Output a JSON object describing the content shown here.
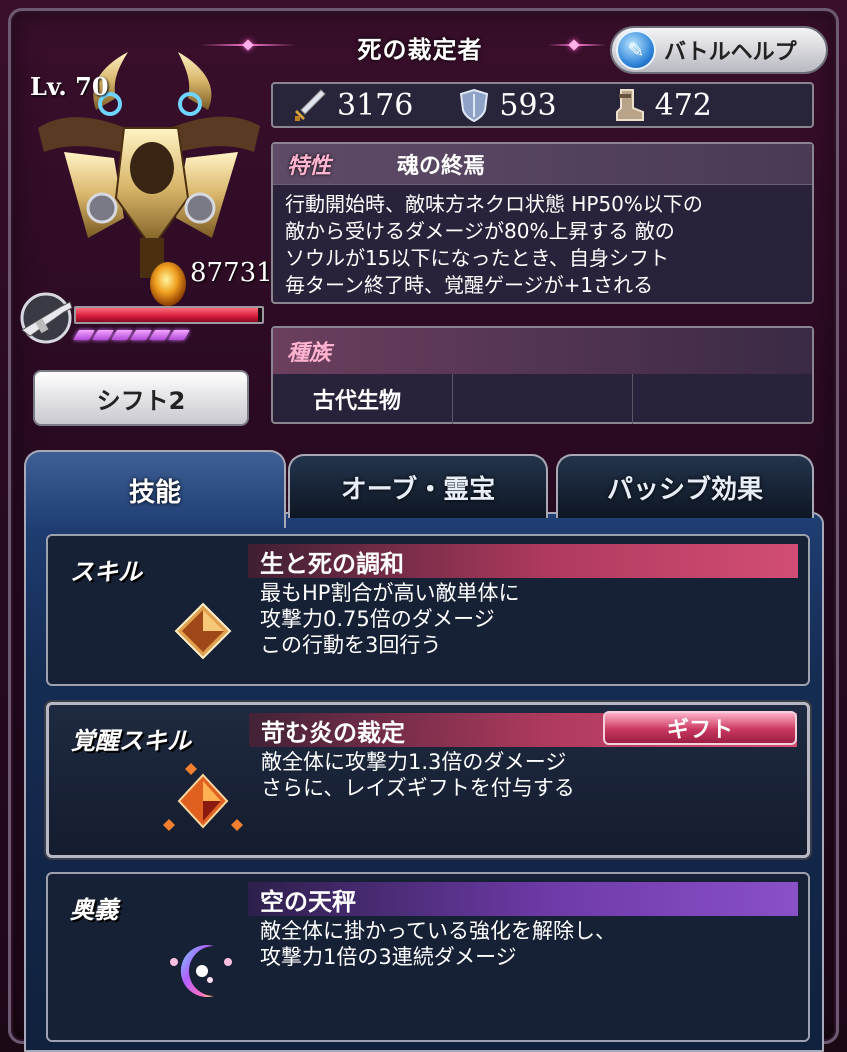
{
  "header": {
    "title": "死の裁定者",
    "battle_help_label": "バトルヘルプ"
  },
  "unit": {
    "level": "Lv. 70",
    "hp": "87731",
    "hp_fill_fraction": 0.98,
    "soul_gauge_pips": 6,
    "shift_label": "シフト2"
  },
  "stats": {
    "attack": "3176",
    "defense": "593",
    "speed": "472"
  },
  "trait": {
    "label": "特性",
    "name": "魂の終焉",
    "lines": [
      "行動開始時、敵味方ネクロ状態 HP50%以下の",
      "敵から受けるダメージが80%上昇する 敵の",
      "ソウルが15以下になったとき、自身シフト",
      "毎ターン終了時、覚醒ゲージが+1される"
    ]
  },
  "race": {
    "label": "種族",
    "cells": [
      "古代生物",
      "",
      ""
    ]
  },
  "tabs": [
    {
      "label": "技能",
      "active": true
    },
    {
      "label": "オーブ・霊宝",
      "active": false
    },
    {
      "label": "パッシブ効果",
      "active": false
    }
  ],
  "skills": {
    "skill": {
      "type": "スキル",
      "name": "生と死の調和",
      "lines": [
        "最もHP割合が高い敵単体に",
        "攻撃力0.75倍のダメージ",
        "この行動を3回行う"
      ]
    },
    "awaken": {
      "type": "覚醒スキル",
      "name": "苛む炎の裁定",
      "badge": "ギフト",
      "lines": [
        "敵全体に攻撃力1.3倍のダメージ",
        "さらに、レイズギフトを付与する"
      ]
    },
    "ultimate": {
      "type": "奥義",
      "name": "空の天秤",
      "lines": [
        "敵全体に掛かっている強化を解除し、",
        "攻撃力1倍の3連続ダメージ"
      ]
    }
  },
  "icons": {
    "battle_help": "help-book-icon",
    "attack": "sword-icon",
    "defense": "shield-icon",
    "speed": "boot-icon",
    "weapon": "gun-weapon-icon",
    "skill": "orange-crystal-icon",
    "awaken": "fire-crystal-icon",
    "ultimate": "crescent-orb-icon"
  }
}
